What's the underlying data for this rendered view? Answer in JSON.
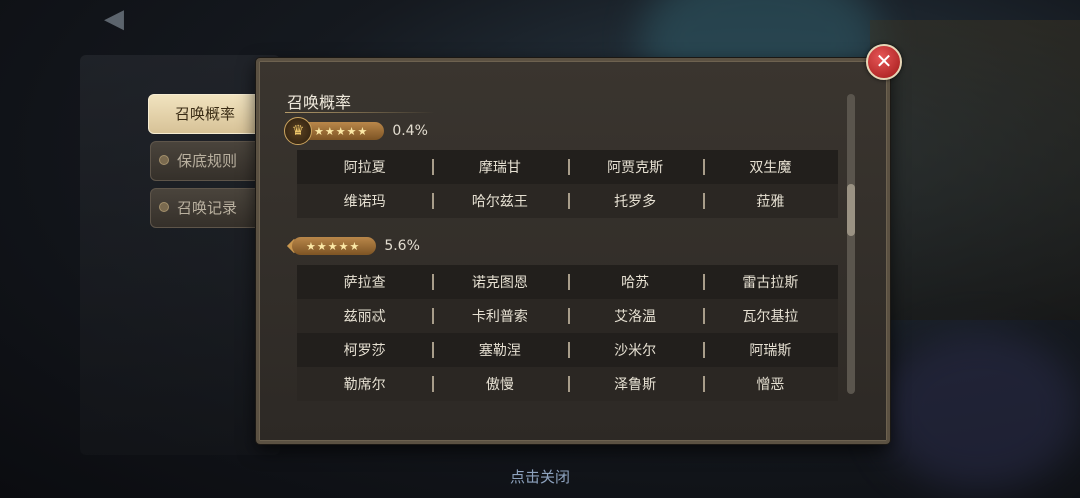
{
  "footer": {
    "tap_close": "点击关闭"
  },
  "tabs": [
    {
      "label": "召唤概率",
      "active": true
    },
    {
      "label": "保底规则",
      "active": false
    },
    {
      "label": "召唤记录",
      "active": false
    }
  ],
  "dialog": {
    "title": "召唤概率",
    "tiers": [
      {
        "stars": "★★★★★",
        "rate": "0.4%",
        "heroes": [
          [
            "阿拉夏",
            "摩瑞甘",
            "阿贾克斯",
            "双生魔"
          ],
          [
            "维诺玛",
            "哈尔兹王",
            "托罗多",
            "菈雅"
          ]
        ]
      },
      {
        "stars": "★★★★★",
        "rate": "5.6%",
        "heroes": [
          [
            "萨拉查",
            "诺克图恩",
            "哈苏",
            "雷古拉斯"
          ],
          [
            "兹丽忒",
            "卡利普索",
            "艾洛温",
            "瓦尔基拉"
          ],
          [
            "柯罗莎",
            "塞勒涅",
            "沙米尔",
            "阿瑞斯"
          ],
          [
            "勒席尔",
            "傲慢",
            "泽鲁斯",
            "憎恶"
          ]
        ]
      }
    ]
  },
  "colors": {
    "accent_gold": "#b9874a",
    "close_red": "#c62a2a"
  },
  "icons": {
    "close": "close-icon",
    "crown": "crown-icon",
    "back": "back-arrow-icon"
  }
}
